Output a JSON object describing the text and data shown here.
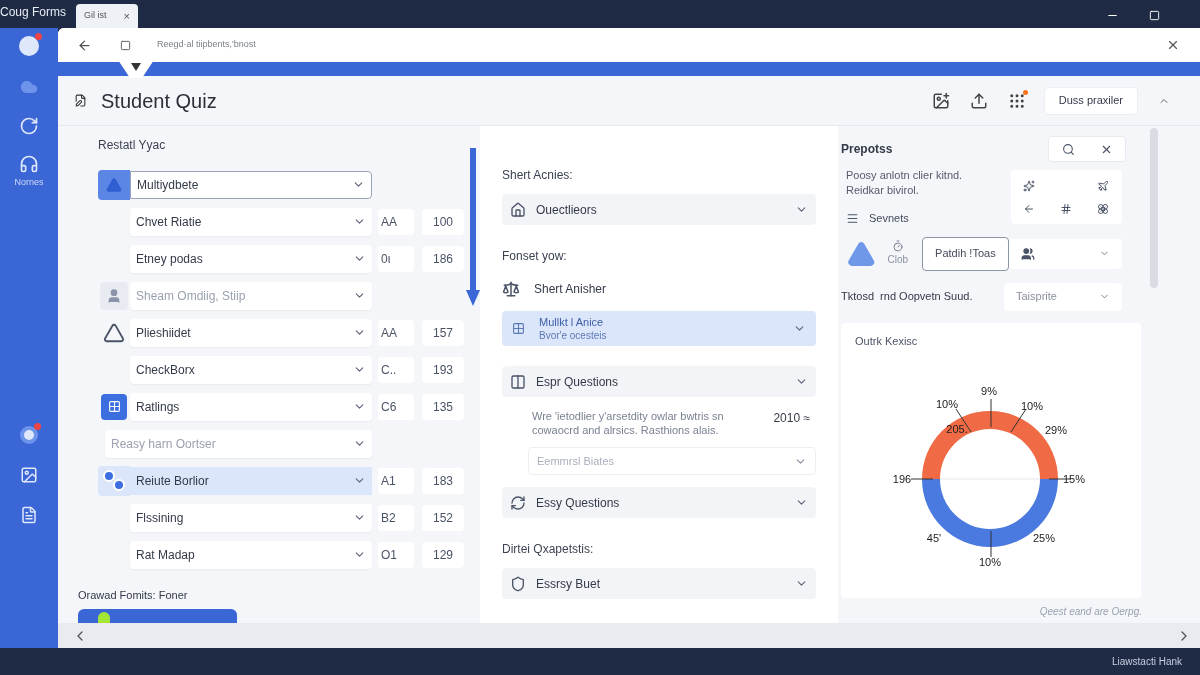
{
  "app_title": "Coug Forms",
  "tab": {
    "label": "Gil ist",
    "close": "×"
  },
  "sidebar": {
    "label": "Nornes"
  },
  "address": "Reegd·al tiipbents,'bnost",
  "header": {
    "title": "Student Quiz",
    "button": "Duss praxiler"
  },
  "left": {
    "heading": "Restatl Yyac",
    "rows": [
      {
        "kind": "filled-triangle",
        "label": "Multiydbete",
        "selected": true,
        "disabled": false
      },
      {
        "kind": "plain",
        "label": "Chvet Riatie",
        "code": "AA",
        "number": "100",
        "selected": false,
        "disabled": false
      },
      {
        "kind": "plain",
        "label": "Etney podas",
        "code": "0ι",
        "number": "186",
        "selected": false,
        "disabled": false
      },
      {
        "kind": "person",
        "label": "Sheam Omdiig, Stiip",
        "selected": false,
        "disabled": true
      },
      {
        "kind": "outline-triangle",
        "label": "Plieshiidet",
        "code": "AA",
        "number": "157",
        "selected": false,
        "disabled": false
      },
      {
        "kind": "plain",
        "label": "CheckBorx",
        "code": "C..",
        "number": "193",
        "selected": false,
        "disabled": false
      },
      {
        "kind": "grid",
        "label": "Ratlings",
        "code": "C6",
        "number": "135",
        "selected": false,
        "disabled": false
      },
      {
        "kind": "wide",
        "label": "Reasy harn Oortser",
        "selected": false,
        "disabled": true
      },
      {
        "kind": "dots",
        "label": "Reiute Borlior",
        "code": "A1",
        "number": "183",
        "selected": true,
        "disabled": false
      },
      {
        "kind": "plain",
        "label": "Flssining",
        "code": "B2",
        "number": "152",
        "selected": false,
        "disabled": false
      },
      {
        "kind": "plain",
        "label": "Rat Madap",
        "code": "O1",
        "number": "129",
        "selected": false,
        "disabled": false
      }
    ],
    "footer": "Orawad Fomits: Foner"
  },
  "middle": [
    {
      "kind": "label",
      "text": "Shert Acnies:"
    },
    {
      "kind": "dropdown",
      "text": "Ouectlieors"
    },
    {
      "kind": "label",
      "text": "Fonset yow:"
    },
    {
      "kind": "item",
      "text": "Shert Anisher"
    },
    {
      "kind": "highlight",
      "text": "Mullkt l Anice",
      "subtext": "Bvor'e ocesteis"
    },
    {
      "kind": "dropdown",
      "text": "Espr Questions"
    },
    {
      "kind": "paragraph",
      "text": "Wre 'ietodlier y'arsetdity owlar bwtris sn cowaocrd and alrsics. Rasthions alais.",
      "aside": "2010 ≈"
    },
    {
      "kind": "faint",
      "text": "Eemmrsl Biates"
    },
    {
      "kind": "dropdown",
      "text": "Essy Questions"
    },
    {
      "kind": "label",
      "text": "Dirtei Qxapetstis:"
    },
    {
      "kind": "dropdown",
      "text": "Essrsy Buet"
    }
  ],
  "right": {
    "heading": "Prepotss",
    "text": "Poosy anlotn clier kitnd. Reidkar bivirol.",
    "menu": "Sevnets",
    "icon_caption": "Clob",
    "button": "Patdih !Toas",
    "caption": "Tktosd  rnd Oopvetn Suud.",
    "select": "Taisprite",
    "chart": {
      "title": "Outrk Kexisc",
      "labels": [
        "9%",
        "10%",
        "10%",
        "205.",
        "29%",
        "196",
        "15%",
        "45'",
        "25%",
        "10%"
      ]
    },
    "footer": "Qeest eand are Oerpg."
  },
  "taskbar_text": "Liawstacti Hank"
}
